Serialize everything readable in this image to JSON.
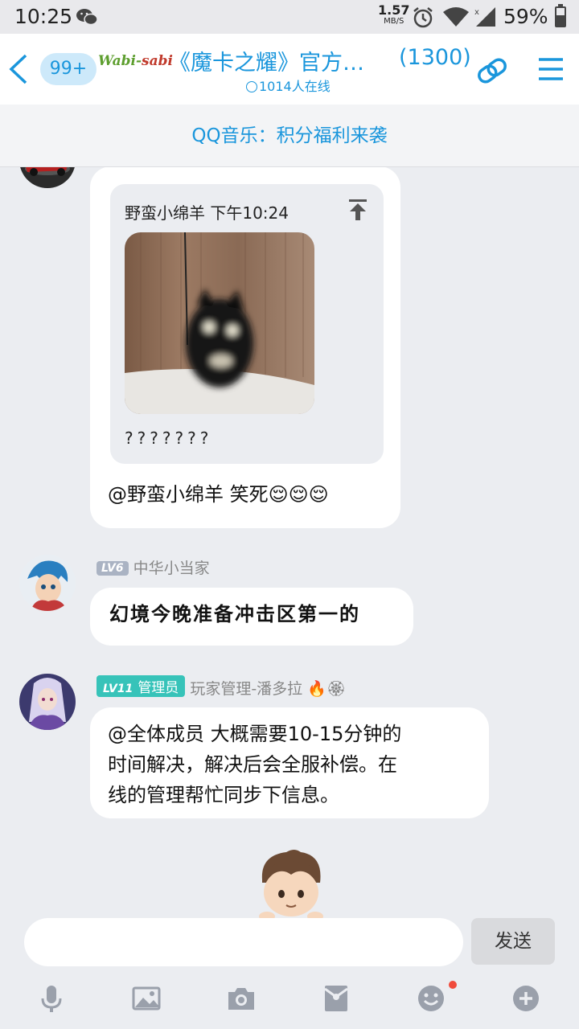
{
  "status_bar": {
    "time": "10:25",
    "net_speed": "1.57",
    "net_unit": "MB/S",
    "battery_text": "59%",
    "battery_level": 0.59
  },
  "header": {
    "badge": "99+",
    "logo_part1": "Wabi-",
    "logo_part2": "sabi",
    "title": "《魔卡之耀》官方…",
    "member_count": "(1300)",
    "online": "1014人在线"
  },
  "banner": {
    "text": "QQ音乐：积分福利来袭"
  },
  "messages": [
    {
      "reply": {
        "author_time": "野蛮小绵羊 下午10:24",
        "text": "???????"
      },
      "text": "@野蛮小绵羊 笑死😌😌😌"
    },
    {
      "level": "LV6",
      "sender": "中华小当家",
      "text": "幻境今晚准备冲击区第一的"
    },
    {
      "level": "LV11",
      "role": "管理员",
      "sender": "玩家管理-潘多拉 🔥🏵",
      "text_line1": "@全体成员 大概需要10-15分钟的",
      "text_line2": "时间解决，解决后会全服补偿。在",
      "text_line3": "线的管理帮忙同步下信息。"
    }
  ],
  "input": {
    "placeholder": "",
    "send_label": "发送"
  },
  "colors": {
    "accent": "#1a96dc",
    "background": "#ebedf1",
    "admin_badge": "#37c3b9"
  },
  "toolbar_icons": [
    "microphone-icon",
    "image-icon",
    "camera-icon",
    "red-packet-icon",
    "emoji-icon",
    "plus-icon"
  ]
}
